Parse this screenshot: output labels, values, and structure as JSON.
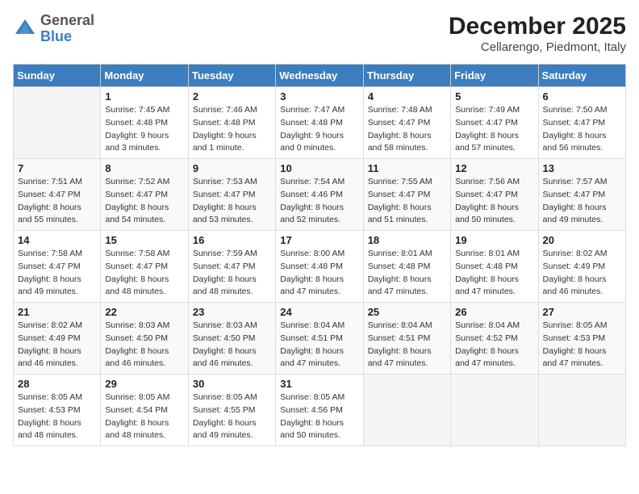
{
  "logo": {
    "text_top": "General",
    "text_bottom": "Blue"
  },
  "title": "December 2025",
  "subtitle": "Cellarengo, Piedmont, Italy",
  "days_of_week": [
    "Sunday",
    "Monday",
    "Tuesday",
    "Wednesday",
    "Thursday",
    "Friday",
    "Saturday"
  ],
  "weeks": [
    [
      {
        "day": "",
        "sunrise": "",
        "sunset": "",
        "daylight": ""
      },
      {
        "day": "1",
        "sunrise": "Sunrise: 7:45 AM",
        "sunset": "Sunset: 4:48 PM",
        "daylight": "Daylight: 9 hours and 3 minutes."
      },
      {
        "day": "2",
        "sunrise": "Sunrise: 7:46 AM",
        "sunset": "Sunset: 4:48 PM",
        "daylight": "Daylight: 9 hours and 1 minute."
      },
      {
        "day": "3",
        "sunrise": "Sunrise: 7:47 AM",
        "sunset": "Sunset: 4:48 PM",
        "daylight": "Daylight: 9 hours and 0 minutes."
      },
      {
        "day": "4",
        "sunrise": "Sunrise: 7:48 AM",
        "sunset": "Sunset: 4:47 PM",
        "daylight": "Daylight: 8 hours and 58 minutes."
      },
      {
        "day": "5",
        "sunrise": "Sunrise: 7:49 AM",
        "sunset": "Sunset: 4:47 PM",
        "daylight": "Daylight: 8 hours and 57 minutes."
      },
      {
        "day": "6",
        "sunrise": "Sunrise: 7:50 AM",
        "sunset": "Sunset: 4:47 PM",
        "daylight": "Daylight: 8 hours and 56 minutes."
      }
    ],
    [
      {
        "day": "7",
        "sunrise": "Sunrise: 7:51 AM",
        "sunset": "Sunset: 4:47 PM",
        "daylight": "Daylight: 8 hours and 55 minutes."
      },
      {
        "day": "8",
        "sunrise": "Sunrise: 7:52 AM",
        "sunset": "Sunset: 4:47 PM",
        "daylight": "Daylight: 8 hours and 54 minutes."
      },
      {
        "day": "9",
        "sunrise": "Sunrise: 7:53 AM",
        "sunset": "Sunset: 4:47 PM",
        "daylight": "Daylight: 8 hours and 53 minutes."
      },
      {
        "day": "10",
        "sunrise": "Sunrise: 7:54 AM",
        "sunset": "Sunset: 4:46 PM",
        "daylight": "Daylight: 8 hours and 52 minutes."
      },
      {
        "day": "11",
        "sunrise": "Sunrise: 7:55 AM",
        "sunset": "Sunset: 4:47 PM",
        "daylight": "Daylight: 8 hours and 51 minutes."
      },
      {
        "day": "12",
        "sunrise": "Sunrise: 7:56 AM",
        "sunset": "Sunset: 4:47 PM",
        "daylight": "Daylight: 8 hours and 50 minutes."
      },
      {
        "day": "13",
        "sunrise": "Sunrise: 7:57 AM",
        "sunset": "Sunset: 4:47 PM",
        "daylight": "Daylight: 8 hours and 49 minutes."
      }
    ],
    [
      {
        "day": "14",
        "sunrise": "Sunrise: 7:58 AM",
        "sunset": "Sunset: 4:47 PM",
        "daylight": "Daylight: 8 hours and 49 minutes."
      },
      {
        "day": "15",
        "sunrise": "Sunrise: 7:58 AM",
        "sunset": "Sunset: 4:47 PM",
        "daylight": "Daylight: 8 hours and 48 minutes."
      },
      {
        "day": "16",
        "sunrise": "Sunrise: 7:59 AM",
        "sunset": "Sunset: 4:47 PM",
        "daylight": "Daylight: 8 hours and 48 minutes."
      },
      {
        "day": "17",
        "sunrise": "Sunrise: 8:00 AM",
        "sunset": "Sunset: 4:48 PM",
        "daylight": "Daylight: 8 hours and 47 minutes."
      },
      {
        "day": "18",
        "sunrise": "Sunrise: 8:01 AM",
        "sunset": "Sunset: 4:48 PM",
        "daylight": "Daylight: 8 hours and 47 minutes."
      },
      {
        "day": "19",
        "sunrise": "Sunrise: 8:01 AM",
        "sunset": "Sunset: 4:48 PM",
        "daylight": "Daylight: 8 hours and 47 minutes."
      },
      {
        "day": "20",
        "sunrise": "Sunrise: 8:02 AM",
        "sunset": "Sunset: 4:49 PM",
        "daylight": "Daylight: 8 hours and 46 minutes."
      }
    ],
    [
      {
        "day": "21",
        "sunrise": "Sunrise: 8:02 AM",
        "sunset": "Sunset: 4:49 PM",
        "daylight": "Daylight: 8 hours and 46 minutes."
      },
      {
        "day": "22",
        "sunrise": "Sunrise: 8:03 AM",
        "sunset": "Sunset: 4:50 PM",
        "daylight": "Daylight: 8 hours and 46 minutes."
      },
      {
        "day": "23",
        "sunrise": "Sunrise: 8:03 AM",
        "sunset": "Sunset: 4:50 PM",
        "daylight": "Daylight: 8 hours and 46 minutes."
      },
      {
        "day": "24",
        "sunrise": "Sunrise: 8:04 AM",
        "sunset": "Sunset: 4:51 PM",
        "daylight": "Daylight: 8 hours and 47 minutes."
      },
      {
        "day": "25",
        "sunrise": "Sunrise: 8:04 AM",
        "sunset": "Sunset: 4:51 PM",
        "daylight": "Daylight: 8 hours and 47 minutes."
      },
      {
        "day": "26",
        "sunrise": "Sunrise: 8:04 AM",
        "sunset": "Sunset: 4:52 PM",
        "daylight": "Daylight: 8 hours and 47 minutes."
      },
      {
        "day": "27",
        "sunrise": "Sunrise: 8:05 AM",
        "sunset": "Sunset: 4:53 PM",
        "daylight": "Daylight: 8 hours and 47 minutes."
      }
    ],
    [
      {
        "day": "28",
        "sunrise": "Sunrise: 8:05 AM",
        "sunset": "Sunset: 4:53 PM",
        "daylight": "Daylight: 8 hours and 48 minutes."
      },
      {
        "day": "29",
        "sunrise": "Sunrise: 8:05 AM",
        "sunset": "Sunset: 4:54 PM",
        "daylight": "Daylight: 8 hours and 48 minutes."
      },
      {
        "day": "30",
        "sunrise": "Sunrise: 8:05 AM",
        "sunset": "Sunset: 4:55 PM",
        "daylight": "Daylight: 8 hours and 49 minutes."
      },
      {
        "day": "31",
        "sunrise": "Sunrise: 8:05 AM",
        "sunset": "Sunset: 4:56 PM",
        "daylight": "Daylight: 8 hours and 50 minutes."
      },
      {
        "day": "",
        "sunrise": "",
        "sunset": "",
        "daylight": ""
      },
      {
        "day": "",
        "sunrise": "",
        "sunset": "",
        "daylight": ""
      },
      {
        "day": "",
        "sunrise": "",
        "sunset": "",
        "daylight": ""
      }
    ]
  ]
}
